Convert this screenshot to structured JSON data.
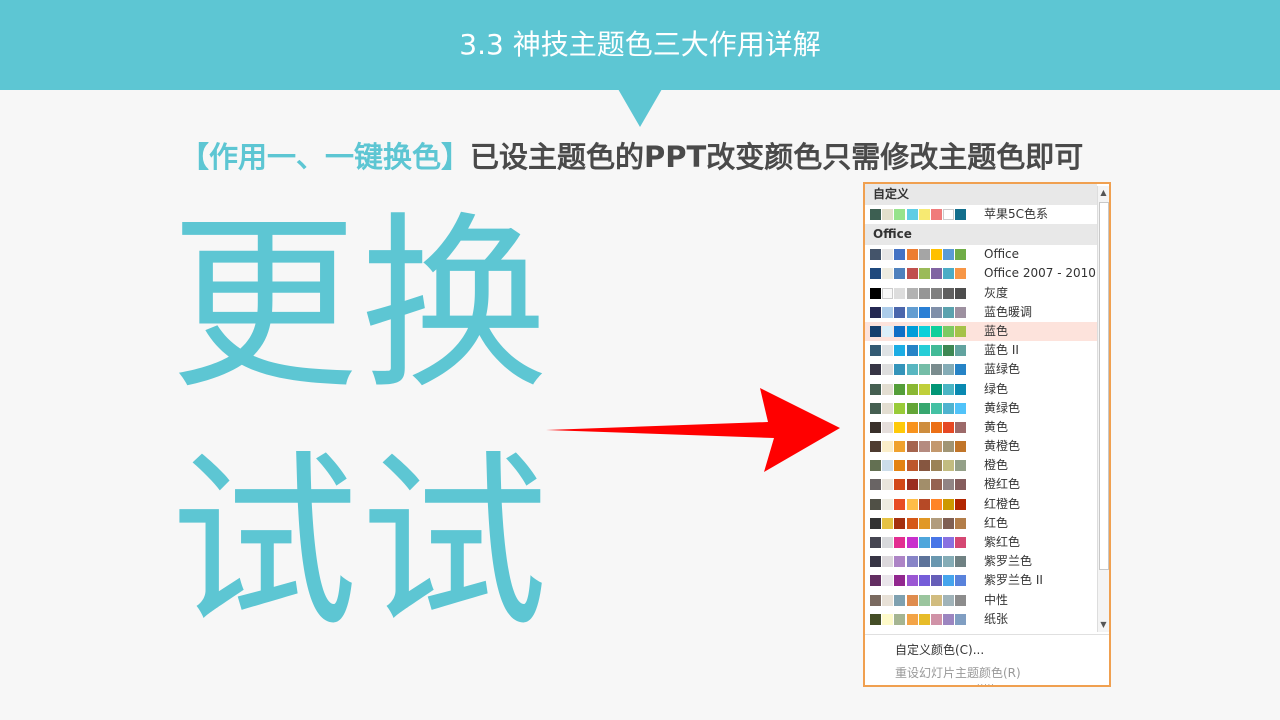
{
  "header": {
    "title": "3.3 神技主题色三大作用详解"
  },
  "subtitle": {
    "highlight": "【作用一、一键换色】",
    "rest": "已设主题色的PPT改变颜色只需修改主题色即可"
  },
  "big_text": {
    "line1": "更换",
    "line2": "试试"
  },
  "colors": {
    "accent": "#5dc6d3",
    "arrow": "#ff0000",
    "panel_border": "#f0a050"
  },
  "panel": {
    "groups": [
      {
        "header": "自定义",
        "themes": [
          {
            "name": "苹果5C色系",
            "colors": [
              "#3d5f52",
              "#e3e0cc",
              "#97e38b",
              "#5fcde4",
              "#f7ea72",
              "#f07b7b",
              "#ffffff",
              "#126e8c"
            ]
          }
        ]
      },
      {
        "header": "Office",
        "themes": [
          {
            "name": "Office",
            "colors": [
              "#44546a",
              "#e7e6e6",
              "#4472c4",
              "#ed7d31",
              "#a5a5a5",
              "#ffc000",
              "#5b9bd5",
              "#70ad47"
            ]
          },
          {
            "name": "Office 2007 - 2010",
            "colors": [
              "#1f497d",
              "#eeece1",
              "#4f81bd",
              "#c0504d",
              "#9bbb59",
              "#8064a2",
              "#4bacc6",
              "#f79646"
            ]
          },
          {
            "name": "灰度",
            "colors": [
              "#000000",
              "#f8f8f8",
              "#dddddd",
              "#b2b2b2",
              "#969696",
              "#808080",
              "#5f5f5f",
              "#4d4d4d"
            ]
          },
          {
            "name": "蓝色暖调",
            "colors": [
              "#242852",
              "#acccea",
              "#4a66ac",
              "#629dd1",
              "#297fd5",
              "#7f8fa9",
              "#5aa2ae",
              "#9d90a0"
            ]
          },
          {
            "name": "蓝色",
            "selected": true,
            "colors": [
              "#17406d",
              "#dbeff9",
              "#0f6fc6",
              "#009dd9",
              "#0bd0d9",
              "#10cf9b",
              "#7cca62",
              "#a5c249"
            ]
          },
          {
            "name": "蓝色 II",
            "colors": [
              "#335b74",
              "#dfe3e5",
              "#1cade4",
              "#2683c6",
              "#27ced7",
              "#42ba97",
              "#3e8853",
              "#62a39f"
            ]
          },
          {
            "name": "蓝绿色",
            "colors": [
              "#373545",
              "#dedede",
              "#3494ba",
              "#58b6c0",
              "#75bda7",
              "#7a8c8e",
              "#84acb6",
              "#2683c6"
            ]
          },
          {
            "name": "绿色",
            "colors": [
              "#455f51",
              "#e3ded1",
              "#549e39",
              "#8ab833",
              "#c0cf3a",
              "#029676",
              "#4ab5c4",
              "#0989b1"
            ]
          },
          {
            "name": "黄绿色",
            "colors": [
              "#455f51",
              "#e3ded1",
              "#99cb38",
              "#63a537",
              "#37a76f",
              "#44c1a3",
              "#4eb3cf",
              "#51c3f9"
            ]
          },
          {
            "name": "黄色",
            "colors": [
              "#39302a",
              "#e5dedb",
              "#ffca08",
              "#f8931d",
              "#ce8d3e",
              "#ec7016",
              "#e64823",
              "#9c6a6a"
            ]
          },
          {
            "name": "黄橙色",
            "colors": [
              "#4e3b30",
              "#fbeec9",
              "#f0a22e",
              "#a5644e",
              "#b58b80",
              "#c3986d",
              "#a19574",
              "#c17529"
            ]
          },
          {
            "name": "橙色",
            "colors": [
              "#637052",
              "#ccddea",
              "#e48312",
              "#bd582c",
              "#865640",
              "#9b8357",
              "#c2bc80",
              "#94a088"
            ]
          },
          {
            "name": "橙红色",
            "colors": [
              "#696464",
              "#e9e5dc",
              "#d34817",
              "#9b2d1f",
              "#a28e6a",
              "#956251",
              "#918485",
              "#855d5d"
            ]
          },
          {
            "name": "红橙色",
            "colors": [
              "#505046",
              "#eeece1",
              "#e84c22",
              "#ffbd47",
              "#b64926",
              "#ff8427",
              "#cc9900",
              "#b22600"
            ]
          },
          {
            "name": "红色",
            "colors": [
              "#323232",
              "#e5c243",
              "#a5300f",
              "#d55816",
              "#e19825",
              "#b19c7d",
              "#7f5f52",
              "#b27d49"
            ]
          },
          {
            "name": "紫红色",
            "colors": [
              "#454551",
              "#d8d9dc",
              "#e32d91",
              "#c830cc",
              "#4ea6dc",
              "#4775e7",
              "#8971e1",
              "#d54773"
            ]
          },
          {
            "name": "紫罗兰色",
            "colors": [
              "#373545",
              "#dcd8dc",
              "#ad84c6",
              "#8784c7",
              "#5d739a",
              "#6997af",
              "#84acb6",
              "#6f8183"
            ]
          },
          {
            "name": "紫罗兰色 II",
            "colors": [
              "#632e62",
              "#eae5eb",
              "#92278f",
              "#9b57d3",
              "#755dd9",
              "#665eb8",
              "#45a5ed",
              "#5982db"
            ]
          },
          {
            "name": "中性",
            "colors": [
              "#7a6a60",
              "#e8e1d7",
              "#7fa1b0",
              "#df8c4e",
              "#9bc59e",
              "#d1bc7f",
              "#a0b3b9",
              "#8c8c8c"
            ]
          },
          {
            "name": "纸张",
            "colors": [
              "#444d26",
              "#fefac9",
              "#a5b592",
              "#f3a447",
              "#e7bc29",
              "#d092a7",
              "#9c85c0",
              "#809ec2"
            ]
          }
        ]
      }
    ],
    "footer": {
      "customize": "自定义颜色(C)...",
      "reset": "重设幻灯片主题颜色(R)",
      "grip": "....."
    }
  }
}
